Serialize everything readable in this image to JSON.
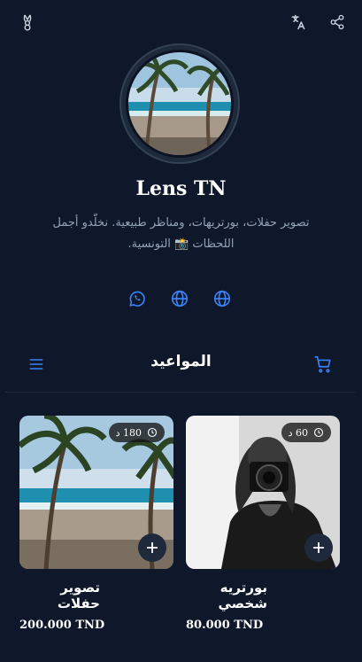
{
  "header": {
    "logo_icon": "bunny-logo-icon",
    "translate_icon": "translate-icon",
    "share_icon": "share-icon"
  },
  "profile": {
    "name": "Lens TN",
    "bio": "تصوير حفلات، بورتريهات، ومناظر طبيعية. نخلّدو أجمل اللحظات 📸 التونسية."
  },
  "social_links": [
    {
      "icon": "whatsapp-icon"
    },
    {
      "icon": "globe-icon"
    },
    {
      "icon": "globe-icon"
    }
  ],
  "section": {
    "title": "المواعيد",
    "menu_icon": "menu-icon",
    "cart_icon": "cart-icon"
  },
  "services": [
    {
      "title": "بورتريه شخصي",
      "price": "80.000 TND",
      "duration": "60 د",
      "image": "photographer-portrait"
    },
    {
      "title": "تصوير حفلات",
      "price": "200.000 TND",
      "duration": "180 د",
      "image": "beach-palms"
    }
  ],
  "colors": {
    "background": "#0f172a",
    "accent": "#3b82f6",
    "muted_text": "#94a3b8"
  }
}
